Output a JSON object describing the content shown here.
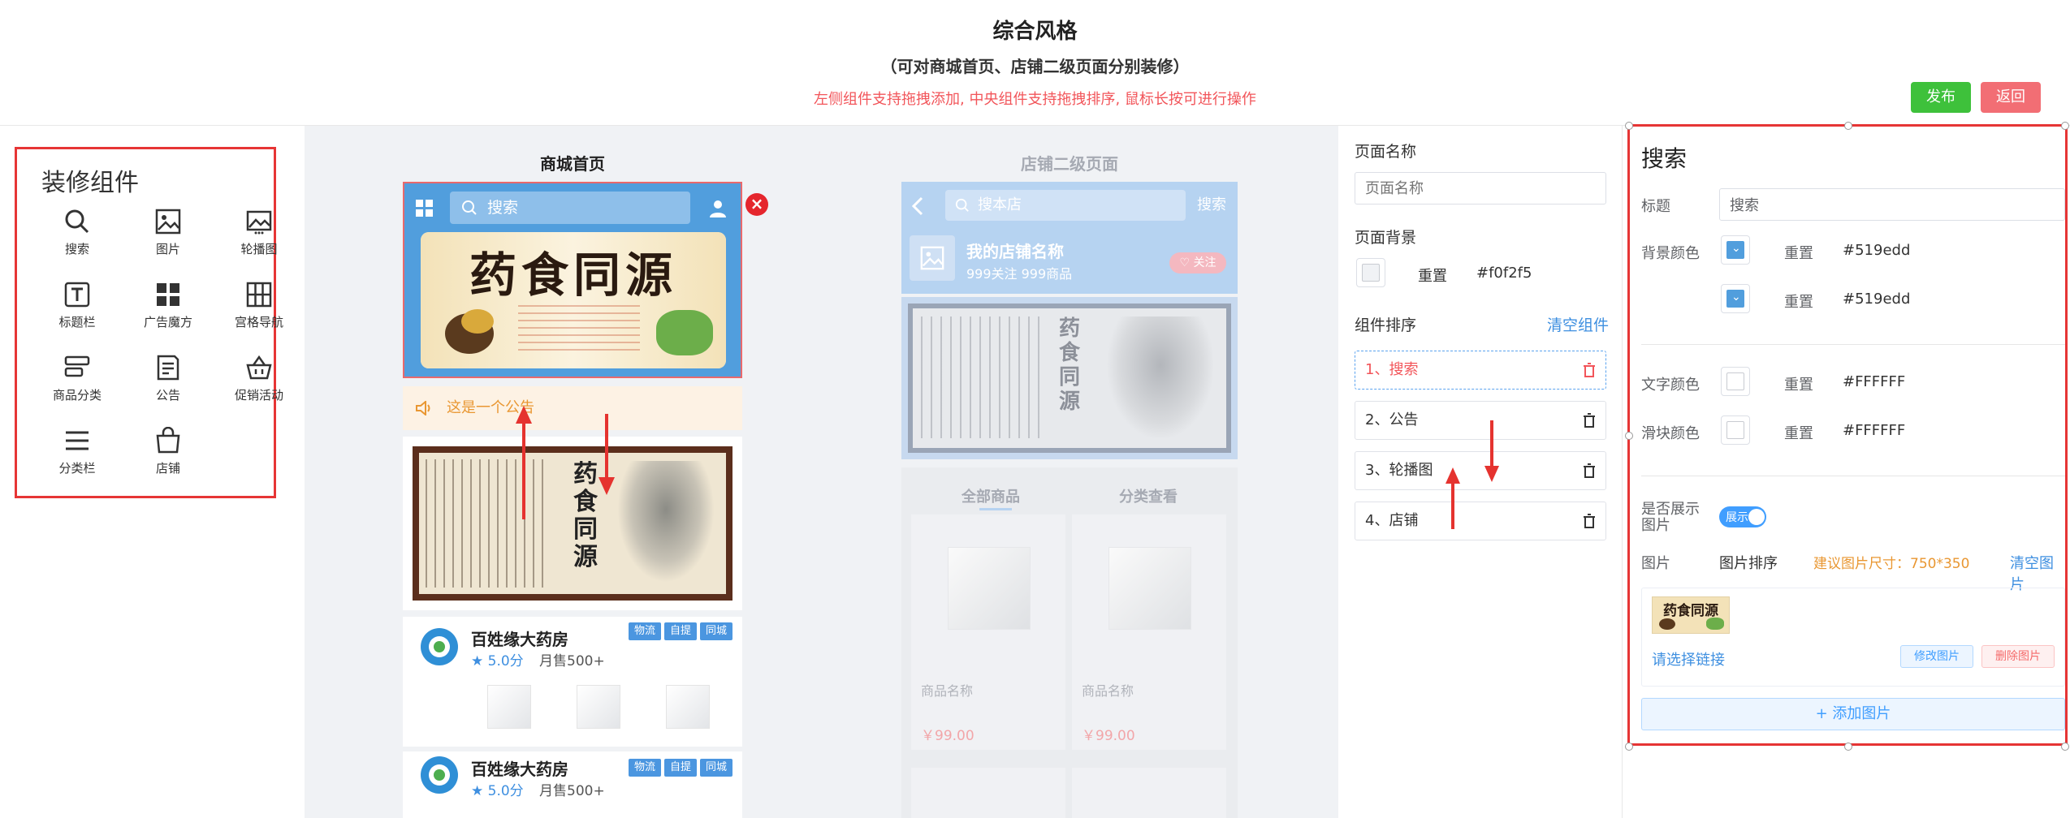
{
  "header": {
    "title": "综合风格",
    "subtitle": "（可对商城首页、店铺二级页面分别装修）",
    "tip": "左侧组件支持拖拽添加, 中央组件支持拖拽排序, 鼠标长按可进行操作",
    "publish_label": "发布",
    "back_label": "返回"
  },
  "components_panel": {
    "title": "装修组件",
    "items": [
      {
        "label": "搜索",
        "icon": "search-icon"
      },
      {
        "label": "图片",
        "icon": "image-icon"
      },
      {
        "label": "轮播图",
        "icon": "carousel-icon"
      },
      {
        "label": "标题栏",
        "icon": "title-icon"
      },
      {
        "label": "广告魔方",
        "icon": "grid-icon"
      },
      {
        "label": "宫格导航",
        "icon": "nav-grid-icon"
      },
      {
        "label": "商品分类",
        "icon": "category-icon"
      },
      {
        "label": "公告",
        "icon": "notice-icon"
      },
      {
        "label": "促销活动",
        "icon": "basket-icon"
      },
      {
        "label": "分类栏",
        "icon": "menu-icon"
      },
      {
        "label": "店铺",
        "icon": "shop-bag-icon"
      }
    ]
  },
  "home_page": {
    "title": "商城首页",
    "search_placeholder": "搜索",
    "banner_text": "药食同源",
    "notice_text": "这是一个公告",
    "carousel_text": "药食同源",
    "stores": [
      {
        "name": "百姓缘大药房",
        "rating": "★ 5.0分",
        "sales": "月售500+",
        "tags": [
          "物流",
          "自提",
          "同城"
        ]
      },
      {
        "name": "百姓缘大药房",
        "rating": "★ 5.0分",
        "sales": "月售500+",
        "tags": [
          "物流",
          "自提",
          "同城"
        ]
      }
    ]
  },
  "shop_page": {
    "title": "店铺二级页面",
    "search_placeholder": "搜本店",
    "search_button": "搜索",
    "shop_name": "我的店铺名称",
    "shop_stats": "999关注 999商品",
    "follow_label": "♡ 关注",
    "banner_text": "药食同源",
    "tabs": [
      "全部商品",
      "分类查看"
    ],
    "goods": [
      {
        "name": "商品名称",
        "price": "￥99.00"
      },
      {
        "name": "商品名称",
        "price": "￥99.00"
      }
    ]
  },
  "page_settings": {
    "name_label": "页面名称",
    "name_placeholder": "页面名称",
    "bg_label": "页面背景",
    "reset_label": "重置",
    "bg_value": "#f0f2f5",
    "sort_label": "组件排序",
    "clear_label": "清空组件",
    "sort_items": [
      "1、搜索",
      "2、公告",
      "3、轮播图",
      "4、店铺"
    ]
  },
  "search_settings": {
    "title": "搜索",
    "title_label": "标题",
    "title_value": "搜索",
    "bg_color_label": "背景颜色",
    "reset_label": "重置",
    "bg_color_1": "#519edd",
    "bg_color_2": "#519edd",
    "text_color_label": "文字颜色",
    "text_color": "#FFFFFF",
    "slider_color_label": "滑块颜色",
    "slider_color": "#FFFFFF",
    "show_image_label_1": "是否展示",
    "show_image_label_2": "图片",
    "toggle_label": "展示",
    "image_label": "图片",
    "image_sort_label": "图片排序",
    "size_hint": "建议图片尺寸：750*350",
    "clear_images_label": "清空图片",
    "choose_link_label": "请选择链接",
    "edit_image_label": "修改图片",
    "delete_image_label": "删除图片",
    "add_image_label": "+ 添加图片"
  },
  "colors": {
    "accent_blue": "#519edd",
    "publish_green": "#3ec13b",
    "back_red": "#f26e74",
    "highlight_red": "#e63535",
    "canvas_bg": "#f0f2f5"
  }
}
